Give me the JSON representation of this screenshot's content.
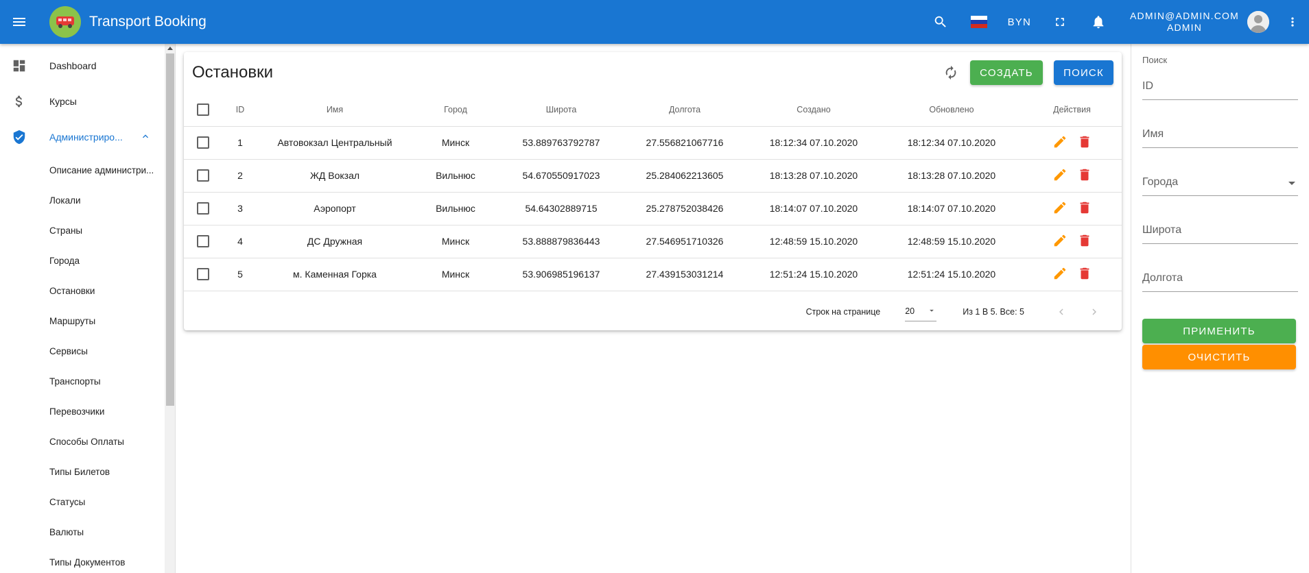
{
  "app": {
    "title": "Transport Booking",
    "currency": "BYN",
    "user_email": "ADMIN@ADMIN.COM",
    "user_role": "ADMIN",
    "accent_color": "#1976d2"
  },
  "sidebar": {
    "items": [
      {
        "label": "Dashboard",
        "icon": "dashboard-icon"
      },
      {
        "label": "Курсы",
        "icon": "dollar-icon"
      },
      {
        "label": "Администриро...",
        "icon": "shield-icon",
        "active": true,
        "expanded": true
      }
    ],
    "subitems": [
      "Описание администри...",
      "Локали",
      "Страны",
      "Города",
      "Остановки",
      "Маршруты",
      "Сервисы",
      "Транспорты",
      "Перевозчики",
      "Способы Оплаты",
      "Типы Билетов",
      "Статусы",
      "Валюты",
      "Типы Документов"
    ]
  },
  "main": {
    "title": "Остановки",
    "create_label": "СОЗДАТЬ",
    "search_label": "ПОИСК",
    "columns": [
      "ID",
      "Имя",
      "Город",
      "Широта",
      "Долгота",
      "Создано",
      "Обновлено",
      "Действия"
    ],
    "rows": [
      {
        "id": "1",
        "name": "Автовокзал Центральный",
        "city": "Минск",
        "lat": "53.889763792787",
        "lon": "27.556821067716",
        "created": "18:12:34 07.10.2020",
        "updated": "18:12:34 07.10.2020"
      },
      {
        "id": "2",
        "name": "ЖД Вокзал",
        "city": "Вильнюс",
        "lat": "54.670550917023",
        "lon": "25.284062213605",
        "created": "18:13:28 07.10.2020",
        "updated": "18:13:28 07.10.2020"
      },
      {
        "id": "3",
        "name": "Аэропорт",
        "city": "Вильнюс",
        "lat": "54.64302889715",
        "lon": "25.278752038426",
        "created": "18:14:07 07.10.2020",
        "updated": "18:14:07 07.10.2020"
      },
      {
        "id": "4",
        "name": "ДС Дружная",
        "city": "Минск",
        "lat": "53.888879836443",
        "lon": "27.546951710326",
        "created": "12:48:59 15.10.2020",
        "updated": "12:48:59 15.10.2020"
      },
      {
        "id": "5",
        "name": "м. Каменная Горка",
        "city": "Минск",
        "lat": "53.906985196137",
        "lon": "27.439153031214",
        "created": "12:51:24 15.10.2020",
        "updated": "12:51:24 15.10.2020"
      }
    ],
    "footer": {
      "rows_per_page_label": "Строк на странице",
      "rows_per_page_value": "20",
      "page_info": "Из 1 В 5. Все: 5"
    }
  },
  "filters": {
    "title": "Поиск",
    "fields": [
      "ID",
      "Имя",
      "Города",
      "Широта",
      "Долгота"
    ],
    "apply_label": "ПРИМЕНИТЬ",
    "clear_label": "ОЧИСТИТЬ"
  }
}
